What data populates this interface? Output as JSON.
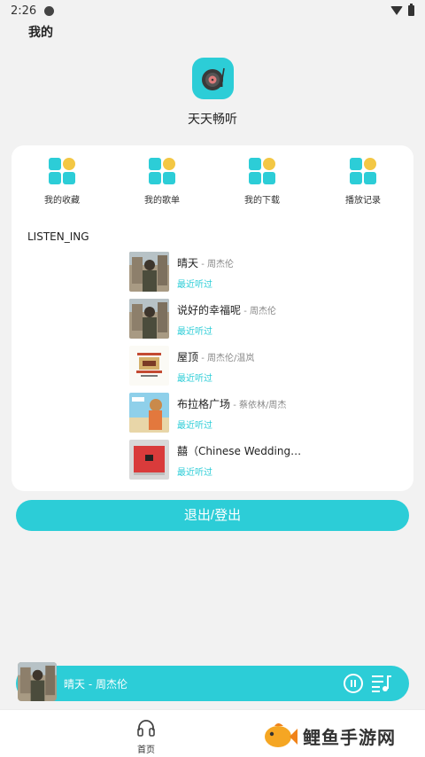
{
  "status": {
    "time": "2:26"
  },
  "page": {
    "title": "我的"
  },
  "app": {
    "name": "天天畅听"
  },
  "quick_actions": [
    {
      "label": "我的收藏",
      "icon": "grid-apps-icon"
    },
    {
      "label": "我的歌单",
      "icon": "grid-apps-icon"
    },
    {
      "label": "我的下载",
      "icon": "grid-apps-icon"
    },
    {
      "label": "播放记录",
      "icon": "grid-apps-icon"
    }
  ],
  "section": {
    "title": "LISTEN_ING"
  },
  "songs": [
    {
      "title": "晴天",
      "artist": " - 周杰伦",
      "tag": "最近听过"
    },
    {
      "title": "说好的幸福呢",
      "artist": " - 周杰伦",
      "tag": "最近听过"
    },
    {
      "title": "屋顶",
      "artist": " - 周杰伦/温岚",
      "tag": "最近听过"
    },
    {
      "title": "布拉格广场",
      "artist": " - 蔡依林/周杰",
      "tag": "最近听过"
    },
    {
      "title": "囍（Chinese Wedding…",
      "artist": "",
      "tag": "最近听过"
    }
  ],
  "logout": {
    "label": "退出/登出"
  },
  "player": {
    "now_playing": "晴天 - 周杰伦"
  },
  "tabbar": {
    "home": "首页"
  },
  "watermark": {
    "text": "鲤鱼手游网"
  },
  "colors": {
    "accent": "#2ccdd7",
    "yellow": "#f3c744"
  }
}
